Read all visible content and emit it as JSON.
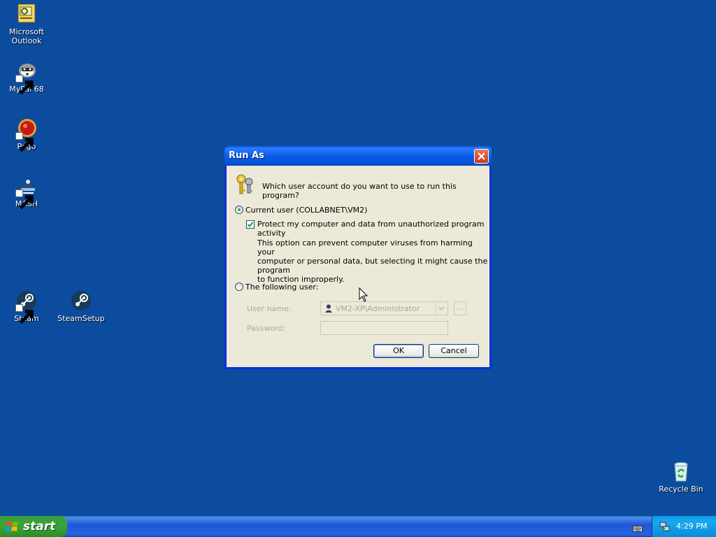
{
  "desktop": {
    "icons": [
      {
        "label_line1": "Microsoft",
        "label_line2": "Outlook",
        "icon": "outlook-icon"
      },
      {
        "label_line1": "MyPal 68",
        "label_line2": "",
        "icon": "mypal-icon"
      },
      {
        "label_line1": "Pego",
        "label_line2": "",
        "icon": "pego-icon"
      },
      {
        "label_line1": "MASH",
        "label_line2": "",
        "icon": "mash-icon"
      },
      {
        "label_line1": "Steam",
        "label_line2": "",
        "icon": "steam-icon"
      },
      {
        "label_line1": "SteamSetup",
        "label_line2": "",
        "icon": "steam-setup-icon"
      },
      {
        "label_line1": "Recycle Bin",
        "label_line2": "",
        "icon": "recycle-bin-icon"
      }
    ]
  },
  "dialog": {
    "title": "Run As",
    "question": "Which user account do you want to use to run this program?",
    "current_user_label": "Current user (COLLABNET\\VM2)",
    "current_user_selected": true,
    "protect_label": "Protect my computer and data from unauthorized program activity",
    "protect_checked": true,
    "description_line1": "This option can prevent computer viruses from harming your",
    "description_line2": "computer or personal data, but selecting it might cause the program",
    "description_line3": "to function improperly.",
    "following_user_label": "The following user:",
    "user_name_label": "User name:",
    "user_name_value": "VM2-XP\\Administrator",
    "browse_label": "...",
    "password_label": "Password:",
    "password_value": "",
    "ok_label": "OK",
    "cancel_label": "Cancel"
  },
  "taskbar": {
    "start_label": "start",
    "clock": "4:29 PM"
  },
  "colors": {
    "desktop_bg": "#0c4c9f",
    "title_bar": "#0a5ce8",
    "dialog_face": "#ece9d8",
    "start_green": "#37a537"
  }
}
